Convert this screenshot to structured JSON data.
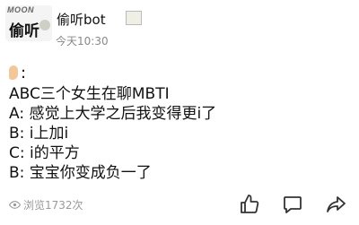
{
  "post": {
    "username": "偷听bot",
    "timestamp": "今天10:30",
    "avatar_brand": "MOON",
    "avatar_text": "偷听",
    "emoji_suffix": ":",
    "lines": [
      "ABC三个女生在聊MBTI",
      "A: 感觉上大学之后我变得更i了",
      "B: i上加i",
      "C: i的平方",
      "B: 宝宝你变成负一了"
    ]
  },
  "footer": {
    "views": "浏览1732次"
  },
  "icons": {
    "view": "eye-icon",
    "like": "thumbs-up-icon",
    "comment": "comment-icon",
    "share": "share-icon"
  }
}
